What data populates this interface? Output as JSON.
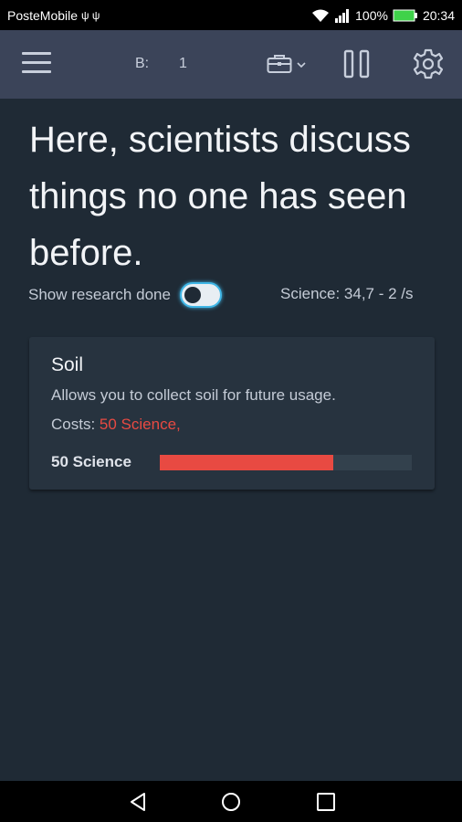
{
  "status_bar": {
    "carrier": "PosteMobile",
    "battery": "100%",
    "time": "20:34"
  },
  "app_bar": {
    "b_label": "B:",
    "b_value": "1"
  },
  "headline": "Here, scientists discuss things no one has seen before.",
  "toggle": {
    "label": "Show research done",
    "checked": false
  },
  "science_rate": "Science: 34,7 - 2 /s",
  "research_card": {
    "title": "Soil",
    "description": "Allows you to collect soil for future usage.",
    "costs_label": "Costs:",
    "costs_value": "50 Science,",
    "progress_label": "50 Science",
    "progress_fraction": 0.69
  },
  "colors": {
    "background": "#1f2a35",
    "app_bar": "#3b4459",
    "accent_red": "#e84a42",
    "toggle_border": "#3fb6e6"
  },
  "icons": [
    "menu-icon",
    "briefcase-icon",
    "chevron-down-icon",
    "columns-icon",
    "gear-icon",
    "back-icon",
    "home-icon",
    "recent-apps-icon"
  ]
}
